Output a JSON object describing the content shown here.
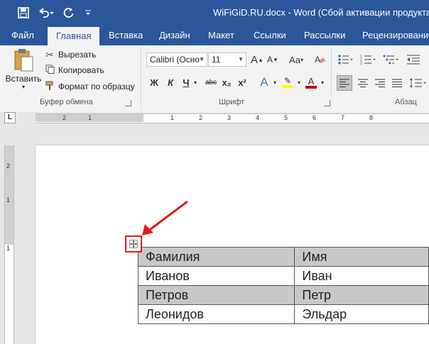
{
  "window": {
    "title": "WiFiGiD.RU.docx - Word (Сбой активации продукта)",
    "quick_access": [
      "save-icon",
      "undo-icon",
      "redo-icon",
      "customize-icon"
    ]
  },
  "tabs": [
    {
      "label": "Файл",
      "active": false
    },
    {
      "label": "Главная",
      "active": true
    },
    {
      "label": "Вставка",
      "active": false
    },
    {
      "label": "Дизайн",
      "active": false
    },
    {
      "label": "Макет",
      "active": false
    },
    {
      "label": "Ссылки",
      "active": false
    },
    {
      "label": "Рассылки",
      "active": false
    },
    {
      "label": "Рецензирование",
      "active": false
    }
  ],
  "clipboard": {
    "paste_label": "Вставить",
    "cut_label": "Вырезать",
    "copy_label": "Копировать",
    "format_painter_label": "Формат по образцу",
    "group_label": "Буфер обмена"
  },
  "font": {
    "font_name": "Calibri (Осно",
    "font_size": "11",
    "grow_label": "A",
    "shrink_label": "A",
    "case_label": "Aa",
    "bold": "Ж",
    "italic": "К",
    "underline": "Ч",
    "strike": "abc",
    "subscript": "x₂",
    "superscript": "x²",
    "effects": "A",
    "highlight_color": "#ffff00",
    "font_color": "#c00000",
    "group_label": "Шрифт"
  },
  "paragraph": {
    "group_label": "Абзац"
  },
  "ruler": {
    "h_labels": [
      "2",
      "1",
      "1",
      "2",
      "3",
      "4",
      "5",
      "6",
      "7",
      "8"
    ],
    "v_labels": [
      "2",
      "1",
      "1"
    ]
  },
  "document": {
    "table": [
      [
        "Фамилия",
        "Имя"
      ],
      [
        "Иванов",
        "Иван"
      ],
      [
        "Петров",
        "Петр"
      ],
      [
        "Леонидов",
        "Эльдар"
      ]
    ]
  },
  "colors": {
    "accent": "#2b579a",
    "annotation": "#e01b1b"
  }
}
